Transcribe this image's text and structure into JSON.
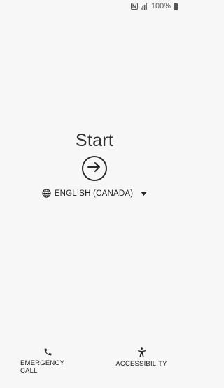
{
  "status_bar": {
    "battery_percent": "100%",
    "icons": [
      "nfc-icon",
      "signal-icon",
      "battery-icon"
    ]
  },
  "main": {
    "title": "Start",
    "start_button_icon": "arrow-right-circle-icon",
    "language": {
      "label": "ENGLISH (CANADA)",
      "icon": "globe-icon",
      "dropdown_icon": "caret-down-icon"
    }
  },
  "bottom": {
    "emergency": {
      "label": "EMERGENCY CALL",
      "icon": "phone-icon"
    },
    "accessibility": {
      "label": "ACCESSIBILITY",
      "icon": "accessibility-icon"
    }
  },
  "colors": {
    "background": "#f7f7f7",
    "text": "#222222"
  }
}
